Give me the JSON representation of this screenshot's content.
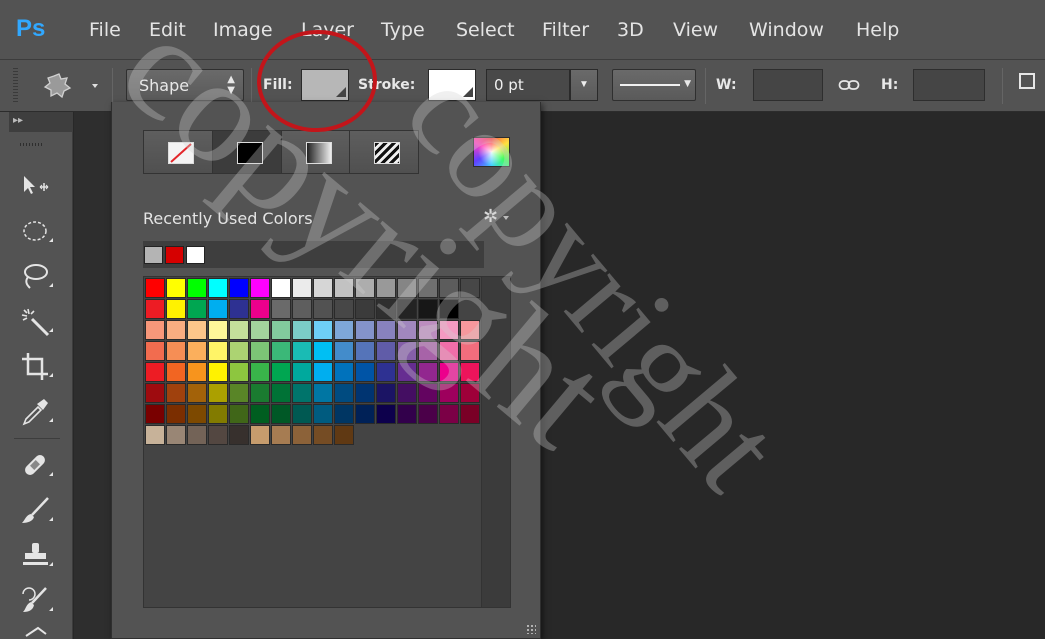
{
  "app": {
    "logo_text": "Ps"
  },
  "menu": [
    "File",
    "Edit",
    "Image",
    "Layer",
    "Type",
    "Select",
    "Filter",
    "3D",
    "View",
    "Window",
    "Help"
  ],
  "options_bar": {
    "mode_label": "Shape",
    "fill_label": "Fill:",
    "stroke_label": "Stroke:",
    "stroke_width": "0 pt",
    "w_label": "W:",
    "h_label": "H:",
    "colors": {
      "fill_swatch": "#b7b7b7",
      "stroke_swatch": "#ffffff"
    }
  },
  "tools_panel": {
    "collapse_icon": "double-chevron-right-icon",
    "icons": [
      "path-selection-icon",
      "ellipse-marquee-icon",
      "lasso-icon",
      "magic-wand-icon",
      "crop-icon",
      "eyedropper-icon",
      "healing-brush-icon",
      "brush-icon",
      "clone-stamp-icon",
      "history-brush-icon"
    ]
  },
  "fill_popup": {
    "modes": [
      "no-color-icon",
      "solid-color-icon",
      "gradient-icon",
      "pattern-icon"
    ],
    "active_mode_index": 1,
    "picker_icon": "color-picker-icon",
    "recent_label": "Recently Used Colors",
    "settings_icon": "gear-icon",
    "recent_colors": [
      "#b4b4b4",
      "#d60000",
      "#ffffff"
    ],
    "swatch_rows": [
      [
        "#ff0000",
        "#ffff00",
        "#00ff00",
        "#00ffff",
        "#0000ff",
        "#ff00ff",
        "#ffffff",
        "#ebebeb",
        "#d6d6d6",
        "#c2c2c2",
        "#adadad",
        "#999999",
        "#858585",
        "#707070",
        "#5c5c5c",
        "#474747"
      ],
      [
        "#ed1c24",
        "#fff200",
        "#00a651",
        "#00aeef",
        "#2e3192",
        "#ec008c",
        "#6a6a6a",
        "#5e5e5e",
        "#525252",
        "#474747",
        "#3b3b3b",
        "#2f2f2f",
        "#232323",
        "#171717",
        "#000000"
      ],
      [
        "#f7977a",
        "#f9ad81",
        "#fdc68a",
        "#fff79a",
        "#c4df9b",
        "#a2d39c",
        "#82ca9d",
        "#7bcdc8",
        "#6ecff6",
        "#7ea7d8",
        "#8493ca",
        "#8882be",
        "#a187be",
        "#bc8dbf",
        "#f49ac2",
        "#f6989d"
      ],
      [
        "#f26c4f",
        "#f68e55",
        "#fbaf5c",
        "#fff467",
        "#acd372",
        "#7cc576",
        "#3bb878",
        "#1abbb4",
        "#00bff3",
        "#438ccb",
        "#5574b9",
        "#605ca8",
        "#855fa8",
        "#a763a8",
        "#f06ea9",
        "#f26d7d"
      ],
      [
        "#ed1c24",
        "#f26522",
        "#f7941d",
        "#fff200",
        "#8dc63f",
        "#39b54a",
        "#00a651",
        "#00a99d",
        "#00aeef",
        "#0072bc",
        "#0054a6",
        "#2e3192",
        "#662d91",
        "#92278f",
        "#ec008c",
        "#ed145b"
      ],
      [
        "#9e0b0f",
        "#a0410d",
        "#a36209",
        "#aba000",
        "#598527",
        "#1a7b30",
        "#007236",
        "#00746b",
        "#0076a3",
        "#004b80",
        "#003471",
        "#1b1464",
        "#440e62",
        "#630460",
        "#9e005d",
        "#9e0039"
      ],
      [
        "#790000",
        "#7b2e00",
        "#7d4900",
        "#827b00",
        "#406618",
        "#005e20",
        "#005826",
        "#005952",
        "#005b7f",
        "#003663",
        "#002157",
        "#0d004c",
        "#32004b",
        "#4b0049",
        "#7b0046",
        "#7a0026"
      ],
      [
        "#c7b299",
        "#998675",
        "#736357",
        "#534741",
        "#37302d",
        "#c69c6d",
        "#a67c52",
        "#8c6239",
        "#754c24",
        "#603913"
      ]
    ]
  },
  "watermark": "copyright"
}
